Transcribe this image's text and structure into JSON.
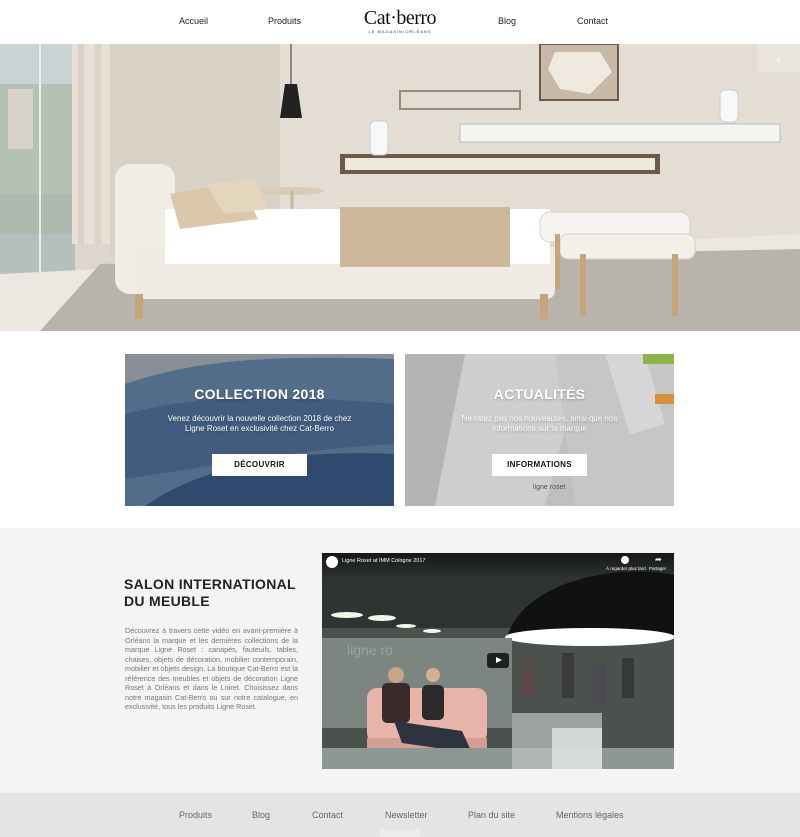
{
  "header": {
    "nav_left": [
      "Accueil",
      "Produits"
    ],
    "nav_right": [
      "Blog",
      "Contact"
    ],
    "logo_main": "Cat·berro",
    "logo_sub": "LE MAGASIN•ORLÉANS"
  },
  "hero": {
    "arrow_icon": "chevron-left-icon",
    "arrow_glyph": "‹"
  },
  "cards": [
    {
      "title": "COLLECTION 2018",
      "text": "Venez découvrir la nouvelle collection 2018 de chez Ligne Roset en exclusivité chez Cat-Berro",
      "button": "DÉCOUVRIR"
    },
    {
      "title": "ACTUALITÉS",
      "text": "Ne ratez pas nos nouveautés, ainsi que nos informations sur la marque",
      "button": "INFORMATIONS"
    }
  ],
  "salon": {
    "title": "SALON INTERNATIONAL DU MEUBLE",
    "text": "Découvrez à travers cette vidéo en avant-première à Orléans la marque et les dernières collections de la marque Ligne Roset : canapés, fauteuils, tables, chaises, objets de décoration, mobilier contemporain, mobilier et objets design. La boutique Cat-Berro est la référence des meubles et objets de décoration Ligne Roset à Orléans et dans le Loiret. Choisissez dans notre magasin Cat-Berro ou sur notre catalogue, en exclusivité, tous les produits Ligne Roset.",
    "video": {
      "title": "Ligne Roset at IMM Cologne 2017",
      "watch_later": "À regarder plus tard",
      "share": "Partager"
    }
  },
  "footer": {
    "links": [
      "Produits",
      "Blog",
      "Contact",
      "Newsletter",
      "Plan du site",
      "Mentions légales"
    ]
  }
}
